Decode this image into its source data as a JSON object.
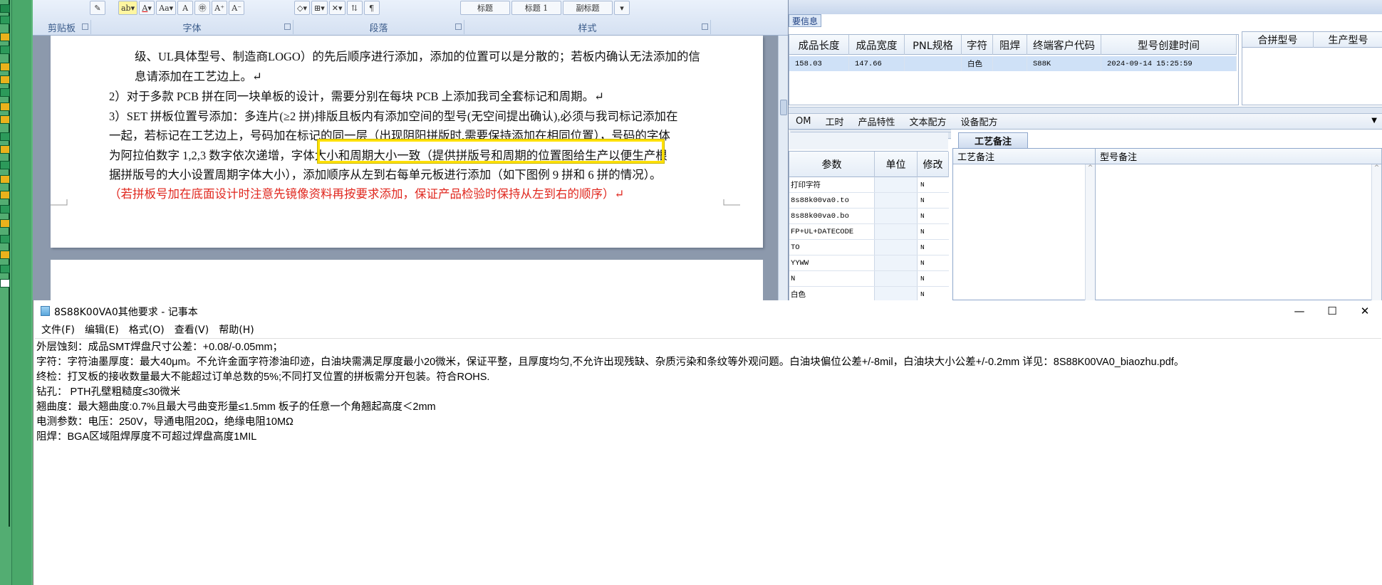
{
  "word": {
    "ribbon": {
      "group_labels": [
        "剪贴板",
        "字体",
        "段落",
        "样式"
      ],
      "style_items": [
        "标题",
        "标题 1",
        "副标题"
      ]
    },
    "document_lines": [
      "级、UL具体型号、制造商LOGO）的先后顺序进行添加，添加的位置可以是分散的；若板内确认无法添加的信",
      "息请添加在工艺边上。↵",
      "2）对于多款 PCB 拼在同一块单板的设计，需要分别在每块 PCB 上添加我司全套标记和周期。↵",
      "3）SET 拼板位置号添加：多连片(≥2 拼)排版且板内有添加空间的型号(无空间提出确认),必须与我司标记添加在",
      "一起，若标记在工艺边上，号码加在标记的同一层（出现阴阳拼版时,需要保持添加在相同位置），号码的字体",
      "为阿拉伯数字 1,2,3 数字依次递增，字体大小和周期大小一致（提供拼版号和周期的位置图给生产以便生产根",
      "据拼版号的大小设置周期字体大小），添加顺序从左到右每单元板进行添加（如下图例 9 拼和 6 拼的情况）。"
    ],
    "document_red_line": "（若拼板号加在底面设计时注意先镜像资料再按要求添加，保证产品检验时保持从左到右的顺序）↵"
  },
  "erp": {
    "tab_label": "要信息",
    "main_grid": {
      "columns": [
        "成品长度",
        "成品宽度",
        "PNL规格",
        "字符",
        "阻焊",
        "终端客户代码",
        "型号创建时间"
      ],
      "row": [
        "158.03",
        "147.66",
        "",
        "白色",
        "",
        "S88K",
        "2024-09-14 15:25:59"
      ]
    },
    "merge_grid": {
      "columns": [
        "合拼型号",
        "生产型号"
      ]
    },
    "tabs": [
      "OM",
      "工时",
      "产品特性",
      "文本配方",
      "设备配方"
    ],
    "param_grid": {
      "columns": [
        "参数",
        "单位",
        "修改"
      ],
      "rows": [
        [
          "打印字符",
          "N"
        ],
        [
          "8s88k00va0.to",
          "N"
        ],
        [
          "8s88k00va0.bo",
          "N"
        ],
        [
          "FP+UL+DATECODE",
          "N"
        ],
        [
          "TO",
          "N"
        ],
        [
          "YYWW",
          "N"
        ],
        [
          "N",
          "N"
        ],
        [
          "白色",
          "N"
        ]
      ]
    },
    "gongyi": {
      "tab_label": "工艺备注",
      "col1": "工艺备注",
      "col2": "型号备注"
    }
  },
  "notepad": {
    "title": "8S88K00VA0其他要求 - 记事本",
    "menu": [
      "文件(F)",
      "编辑(E)",
      "格式(O)",
      "查看(V)",
      "帮助(H)"
    ],
    "lines": [
      "外层蚀刻：成品SMT焊盘尺寸公差：+0.08/-0.05mm；",
      "字符：字符油墨厚度：最大40μm。不允许金面字符渗油印迹，白油块需满足厚度最小20微米，保证平整，且厚度均匀,不允许出现残缺、杂质污染和条纹等外观问题。白油块偏位公差+/-8mil，白油块大小公差+/-0.2mm 详见：8S88K00VA0_biaozhu.pdf。",
      "终检：打叉板的接收数量最大不能超过订单总数的5%;不同打叉位置的拼板需分开包装。符合ROHS.",
      "钻孔： PTH孔壁粗糙度≤30微米",
      "翘曲度：最大翘曲度:0.7%且最大弓曲变形量≤1.5mm  板子的任意一个角翘起高度＜2mm",
      "电测参数：电压：250V，导通电阻20Ω，绝缘电阻10MΩ",
      "阻焊：BGA区域阻焊厚度不可超过焊盘高度1MIL"
    ]
  },
  "colors": {
    "highlight_box": "#ffe000",
    "doc_red_text": "#e0261d",
    "selected_row": "#cfe1f7",
    "desktop_green": "#5fb87c"
  }
}
